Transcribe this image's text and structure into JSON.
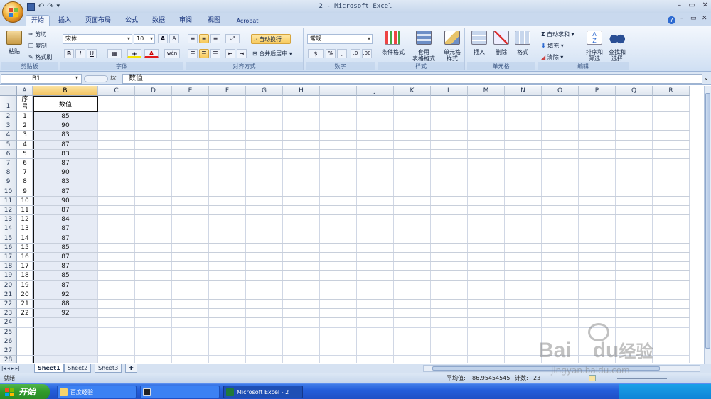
{
  "window": {
    "title": "2 - Microsoft Excel"
  },
  "qat": {
    "undo": "↶",
    "redo": "↷",
    "more": "▾"
  },
  "tabs": [
    "开始",
    "插入",
    "页面布局",
    "公式",
    "数据",
    "审阅",
    "视图",
    "Acrobat"
  ],
  "ribbon": {
    "clipboard": {
      "label": "剪贴板",
      "paste": "粘贴",
      "cut": "剪切",
      "copy": "复制",
      "format_painter": "格式刷"
    },
    "font": {
      "label": "字体",
      "name": "宋体",
      "size": "10",
      "bold": "B",
      "italic": "I",
      "underline": "U",
      "grow": "A",
      "shrink": "A",
      "color": "A",
      "wen": "wén"
    },
    "alignment": {
      "label": "对齐方式",
      "wrap": "自动换行",
      "merge": "合并后居中"
    },
    "number": {
      "label": "数字",
      "format": "常规",
      "percent": "%",
      "comma": ","
    },
    "styles": {
      "label": "样式",
      "conditional": "条件格式",
      "table_line1": "套用",
      "table_line2": "表格格式",
      "cell_line1": "单元格",
      "cell_line2": "样式"
    },
    "cells": {
      "label": "单元格",
      "insert": "插入",
      "delete": "删除",
      "format": "格式"
    },
    "editing": {
      "label": "编辑",
      "autosum": "自动求和",
      "fill": "填充",
      "clear": "清除",
      "sort_line1": "排序和",
      "sort_line2": "筛选",
      "find_line1": "查找和",
      "find_line2": "选择"
    }
  },
  "formula_bar": {
    "name_box": "B1",
    "fx": "fx",
    "content": "数值"
  },
  "columns": [
    "A",
    "B",
    "C",
    "D",
    "E",
    "F",
    "G",
    "H",
    "I",
    "J",
    "K",
    "L",
    "M",
    "N",
    "O",
    "P",
    "Q",
    "R"
  ],
  "rows": [
    "1",
    "2",
    "3",
    "4",
    "5",
    "6",
    "7",
    "8",
    "9",
    "10",
    "11",
    "12",
    "13",
    "14",
    "15",
    "16",
    "17",
    "18",
    "19",
    "20",
    "21",
    "22",
    "23",
    "24",
    "25",
    "26",
    "27",
    "28"
  ],
  "table": {
    "header_a_line1": "序",
    "header_a_line2": "号",
    "header_b": "数值",
    "seq": [
      "1",
      "2",
      "3",
      "4",
      "5",
      "6",
      "7",
      "8",
      "9",
      "10",
      "11",
      "12",
      "13",
      "14",
      "15",
      "16",
      "17",
      "18",
      "19",
      "20",
      "21",
      "22"
    ],
    "values": [
      "85",
      "90",
      "83",
      "87",
      "83",
      "87",
      "90",
      "83",
      "87",
      "90",
      "87",
      "84",
      "87",
      "87",
      "85",
      "87",
      "87",
      "85",
      "87",
      "92",
      "88",
      "92"
    ]
  },
  "sheets": [
    "Sheet1",
    "Sheet2",
    "Sheet3"
  ],
  "status": {
    "ready": "就绪",
    "average_label": "平均值:",
    "average_value": "86.95454545",
    "count_label": "计数:",
    "count_value": "23"
  },
  "taskbar": {
    "start": "开始",
    "tasks": [
      "百度经验",
      "",
      "Microsoft Excel - 2"
    ]
  },
  "watermark": {
    "brand": "Bai",
    "brand2": "du",
    "cn": "经验",
    "url": "jingyan.baidu.com"
  }
}
